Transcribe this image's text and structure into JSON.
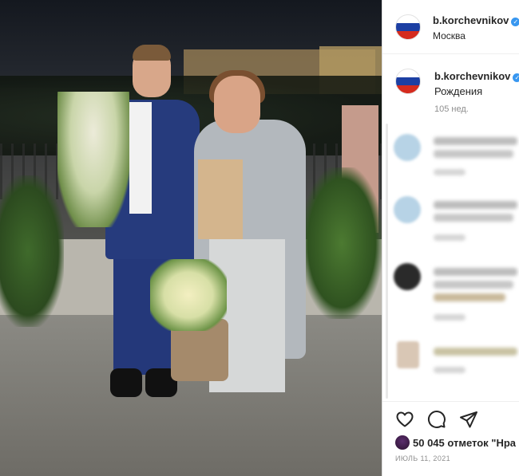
{
  "post": {
    "author": {
      "username": "b.korchevnikov",
      "location": "Москва",
      "avatar_icon": "russian-flag-avatar",
      "verified_icon": "verified-badge-icon"
    },
    "photo_alt": "",
    "caption": {
      "username": "b.korchevnikov",
      "text": "Рождения",
      "time": "105 нед."
    },
    "comments": [
      {
        "username": "",
        "text": "",
        "time": "",
        "avatar_color": "#b7d3e6"
      },
      {
        "username": "",
        "text": "",
        "time": "",
        "avatar_color": "#b7d3e6"
      },
      {
        "username": "",
        "text": "",
        "time": "",
        "avatar_color": "#2a2a2a"
      },
      {
        "username": "",
        "text": "",
        "time": "",
        "avatar_color": "#d9c7b5"
      }
    ],
    "actions": {
      "like_icon": "heart-icon",
      "comment_icon": "comment-icon",
      "share_icon": "send-icon"
    },
    "likes": {
      "text": "50 045 отметок \"Нра"
    },
    "date": "ИЮЛЬ 11, 2021"
  },
  "colors": {
    "verified": "#3897f0",
    "secondary_text": "#8e8e8e",
    "divider": "#dbdbdb"
  }
}
